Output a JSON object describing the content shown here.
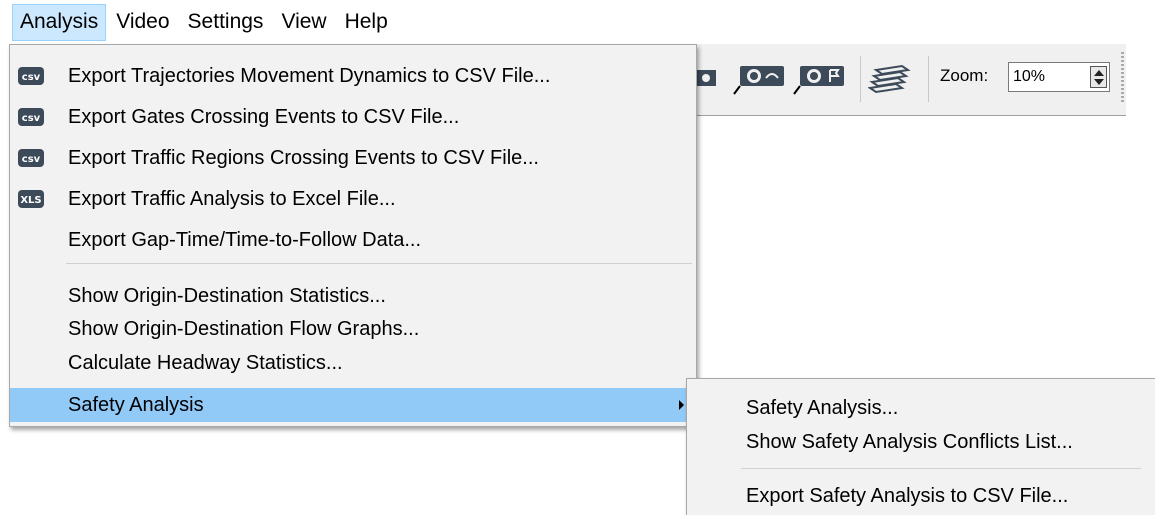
{
  "menubar": {
    "items": [
      "Analysis",
      "Video",
      "Settings",
      "View",
      "Help"
    ]
  },
  "toolbar": {
    "icons": [
      "camera-arrow-icon",
      "camera-refresh-icon",
      "camera-flag-icon",
      "layers-icon"
    ],
    "zoom_label": "Zoom:",
    "zoom_value": "10%"
  },
  "analysis_menu": {
    "items": [
      {
        "label": "Export Trajectories Movement Dynamics to CSV File...",
        "icon": "csv-file-icon",
        "icon_text": "csv"
      },
      {
        "label": "Export Gates Crossing Events to CSV File...",
        "icon": "csv-file-icon",
        "icon_text": "csv"
      },
      {
        "label": "Export Traffic Regions Crossing Events to CSV File...",
        "icon": "csv-file-icon",
        "icon_text": "csv"
      },
      {
        "label": "Export Traffic Analysis to Excel File...",
        "icon": "xls-file-icon",
        "icon_text": "XLS"
      },
      {
        "label": "Export Gap-Time/Time-to-Follow Data..."
      },
      {
        "label": "Show Origin-Destination Statistics..."
      },
      {
        "label": "Show Origin-Destination Flow Graphs..."
      },
      {
        "label": "Calculate Headway Statistics..."
      },
      {
        "label": "Safety Analysis",
        "submenu": true,
        "highlighted": true
      }
    ]
  },
  "safety_submenu": {
    "items": [
      {
        "label": "Safety Analysis..."
      },
      {
        "label": "Show Safety Analysis Conflicts List..."
      },
      {
        "label": "Export Safety Analysis to CSV File..."
      }
    ]
  },
  "colors": {
    "menu_bg": "#f2f2f2",
    "highlight": "#91c9f7",
    "active_menubar": "#cce8ff",
    "icon_fill": "#3c4a59"
  }
}
